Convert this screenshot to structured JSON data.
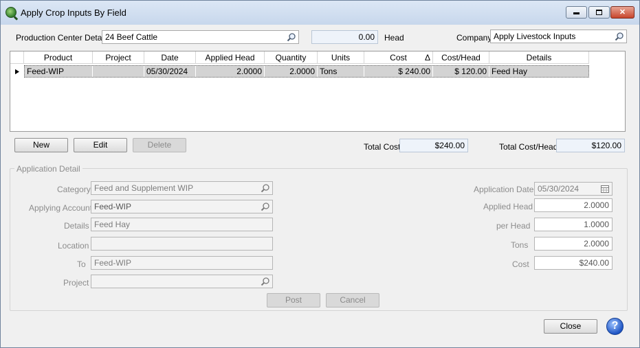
{
  "window": {
    "title": "Apply Crop Inputs By Field"
  },
  "header": {
    "production_center_label": "Production Center Detail",
    "production_center_value": "24 Beef Cattle",
    "head_value": "0.00",
    "head_label": "Head",
    "company_label": "Company",
    "company_value": "Apply Livestock Inputs"
  },
  "grid": {
    "columns": [
      "Product",
      "Project",
      "Date",
      "Applied Head",
      "Quantity",
      "Units",
      "Cost",
      "Cost/Head",
      "Details"
    ],
    "sort_indicator": "Δ",
    "rows": [
      {
        "product": "Feed-WIP",
        "project": "",
        "date": "05/30/2024",
        "applied_head": "2.0000",
        "quantity": "2.0000",
        "units": "Tons",
        "cost": "$ 240.00",
        "cost_head": "$ 120.00",
        "details": "Feed Hay"
      }
    ]
  },
  "actions": {
    "new_label": "New",
    "edit_label": "Edit",
    "delete_label": "Delete"
  },
  "totals": {
    "total_cost_label": "Total Cost",
    "total_cost_value": "$240.00",
    "total_cost_head_label": "Total Cost/Head",
    "total_cost_head_value": "$120.00"
  },
  "detail": {
    "group_title": "Application Detail",
    "category_label": "Category",
    "category_value": "Feed and Supplement WIP",
    "account_label": "Applying Account",
    "account_value": "Feed-WIP",
    "details_label": "Details",
    "details_value": "Feed Hay",
    "location_label": "Location",
    "location_value": "",
    "to_label": "To",
    "to_value": "Feed-WIP",
    "project_label": "Project",
    "project_value": "",
    "application_date_label": "Application Date",
    "application_date_value": "05/30/2024",
    "applied_head_label": "Applied Head",
    "applied_head_value": "2.0000",
    "per_head_label": "per Head",
    "per_head_value": "1.0000",
    "tons_label": "Tons",
    "tons_value": "2.0000",
    "cost_label": "Cost",
    "cost_value": "$240.00",
    "post_label": "Post",
    "cancel_label": "Cancel"
  },
  "footer": {
    "close_label": "Close",
    "help_label": "?"
  },
  "icons": {
    "lookup": "magnifier-icon",
    "calendar": "calendar-icon",
    "row_pointer": "row-pointer-icon"
  }
}
